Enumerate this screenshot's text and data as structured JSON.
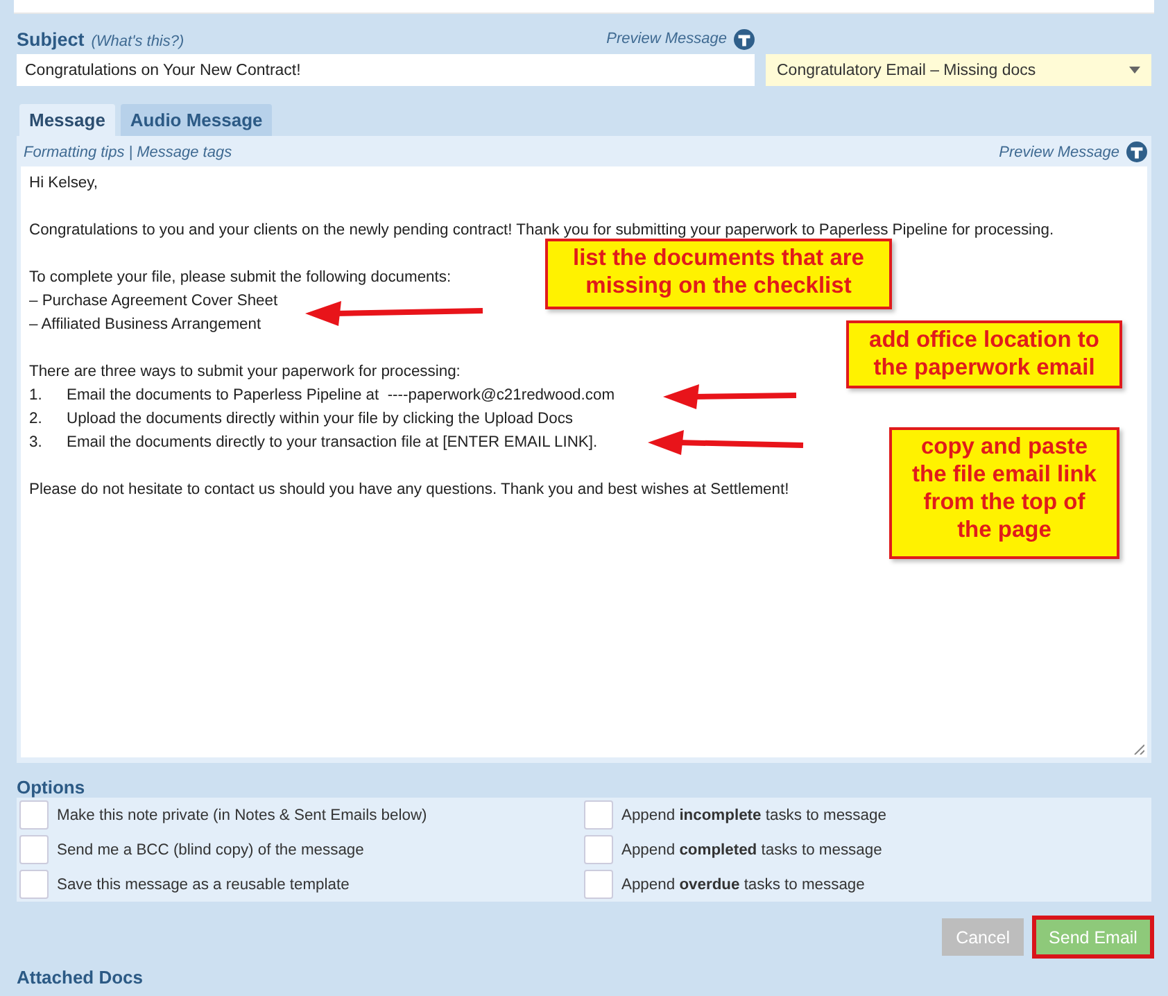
{
  "subject": {
    "label": "Subject",
    "help_link": "(What's this?)",
    "preview_link": "Preview Message",
    "value": "Congratulations on Your New Contract!"
  },
  "template_select": {
    "value": "Congratulatory Email – Missing docs"
  },
  "tabs": [
    {
      "label": "Message",
      "selected": true
    },
    {
      "label": "Audio Message",
      "selected": false
    }
  ],
  "message": {
    "formatting_tips": "Formatting tips",
    "separator": "|",
    "message_tags": "Message tags",
    "preview_link": "Preview Message",
    "paragraphs": [
      [
        {
          "text": "Hi Kelsey,"
        }
      ],
      [
        {
          "text": "Congratulations to you and your clients on the newly pending contract! Thank you for submitting your paperwork to Paperless Pipeline for processing."
        }
      ],
      [
        {
          "text": "To complete your file, please submit the following documents:"
        },
        {
          "text": "– Purchase Agreement Cover Sheet"
        },
        {
          "text": "– Affiliated Business Arrangement"
        }
      ],
      [
        {
          "text": "There are three ways to submit your paperwork for processing:"
        },
        {
          "number": "1.",
          "text": "Email the documents to Paperless Pipeline at  ----paperwork@c21redwood.com"
        },
        {
          "number": "2.",
          "text": "Upload the documents directly within your file by clicking the Upload Docs"
        },
        {
          "number": "3.",
          "text": "Email the documents directly to your transaction file at [ENTER EMAIL LINK]."
        }
      ],
      [
        {
          "text": "Please do not hesitate to contact us should you have any questions. Thank you and best wishes at Settlement!"
        }
      ]
    ]
  },
  "annotations": [
    {
      "lines": [
        "list the documents that are",
        "missing on the checklist"
      ]
    },
    {
      "lines": [
        "add office location to",
        "the paperwork email"
      ]
    },
    {
      "lines": [
        "copy and paste",
        "the file email link",
        "from the top of",
        "the page"
      ]
    }
  ],
  "options": {
    "title": "Options",
    "items": [
      {
        "label": "Make this note private (in Notes & Sent Emails below)",
        "checked": false
      },
      {
        "label": "Append **incomplete** tasks to message",
        "checked": false
      },
      {
        "label": "Send me a BCC (blind copy) of the message",
        "checked": false
      },
      {
        "label": "Append **completed** tasks to message",
        "checked": false
      },
      {
        "label": "Save this message as a reusable template",
        "checked": false
      },
      {
        "label": "Append **overdue** tasks to message",
        "checked": false
      }
    ]
  },
  "buttons": [
    {
      "label": "Cancel",
      "kind": "secondary"
    },
    {
      "label": "Send Email",
      "kind": "primary"
    }
  ],
  "attached_docs": {
    "title": "Attached Docs"
  }
}
